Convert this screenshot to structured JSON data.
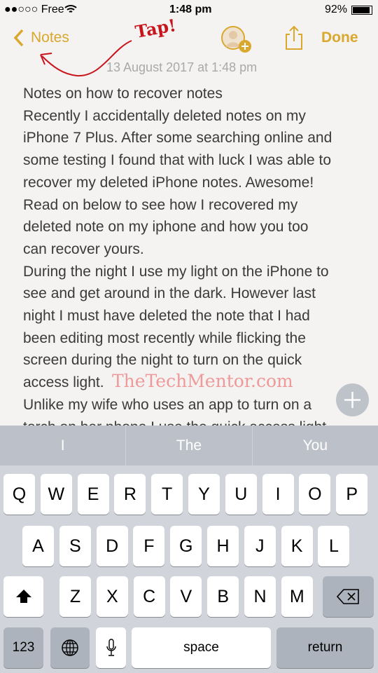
{
  "status": {
    "carrier": "●●○○○ Free",
    "time": "1:48 pm",
    "battery": "92%",
    "battery_level": 0.92
  },
  "nav": {
    "back_label": "Notes",
    "done_label": "Done",
    "annotation": "Tap!",
    "accent": "#d9a82c"
  },
  "note": {
    "date": "13 August 2017 at 1:48 pm",
    "lines": [
      "Notes on how to recover notes",
      "Recently I accidentally deleted notes on my",
      "iPhone 7 Plus. After some searching online and",
      "some testing I found that with luck I was able to",
      "recover my deleted iPhone notes. Awesome!",
      "Read on below to see how I recovered my",
      "deleted note on my iphone and how you too",
      "can recover yours.",
      "During the night I use my light on the iPhone to",
      "see and get around in the dark. However last",
      "night I must have deleted the note that I had",
      "been editing most recently while flicking the",
      "screen during the night to turn on the quick",
      "access light.",
      "Unlike my wife who uses an app to turn on a",
      "torch on her phone I use the quick access light"
    ],
    "watermark": "TheTechMentor.com"
  },
  "keyboard": {
    "suggestions": [
      "I",
      "The",
      "You"
    ],
    "row1": [
      "Q",
      "W",
      "E",
      "R",
      "T",
      "Y",
      "U",
      "I",
      "O",
      "P"
    ],
    "row2": [
      "A",
      "S",
      "D",
      "F",
      "G",
      "H",
      "J",
      "K",
      "L"
    ],
    "row3": [
      "Z",
      "X",
      "C",
      "V",
      "B",
      "N",
      "M"
    ],
    "numbers_label": "123",
    "space_label": "space",
    "return_label": "return"
  }
}
